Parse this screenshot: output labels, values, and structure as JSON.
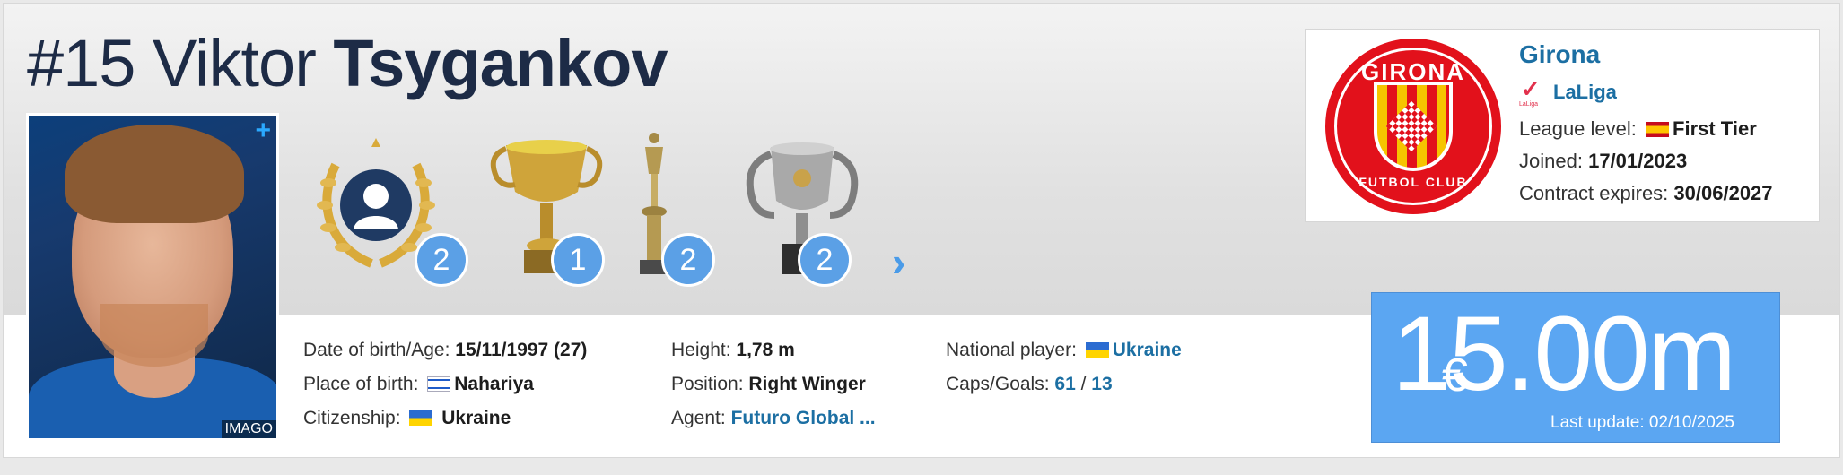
{
  "player": {
    "shirt_number": "#15",
    "first_name": "Viktor",
    "last_name": "Tsygankov",
    "photo_credit": "IMAGO",
    "photo_plus": "+"
  },
  "trophies": [
    {
      "icon": "laurel-portrait-icon",
      "count": "2"
    },
    {
      "icon": "gold-cup-icon",
      "count": "1"
    },
    {
      "icon": "slim-trophy-icon",
      "count": "2"
    },
    {
      "icon": "silver-cup-icon",
      "count": "2"
    }
  ],
  "details": {
    "dob_label": "Date of birth/Age:",
    "dob_value": "15/11/1997 (27)",
    "pob_label": "Place of birth:",
    "pob_value": "Nahariya",
    "citizenship_label": "Citizenship:",
    "citizenship_value": "Ukraine",
    "height_label": "Height:",
    "height_value": "1,78 m",
    "position_label": "Position:",
    "position_value": "Right Winger",
    "agent_label": "Agent:",
    "agent_value": "Futuro Global ...",
    "national_label": "National player:",
    "national_value": "Ukraine",
    "caps_label": "Caps/Goals:",
    "caps_value": "61",
    "caps_sep": "/",
    "goals_value": "13"
  },
  "club": {
    "crest_top_text": "GIRONA",
    "crest_bottom_text": "FUTBOL CLUB",
    "name": "Girona",
    "league": "LaLiga",
    "league_level_label": "League level:",
    "league_level_value": "First Tier",
    "joined_label": "Joined:",
    "joined_value": "17/01/2023",
    "contract_label": "Contract expires:",
    "contract_value": "30/06/2027"
  },
  "market_value": {
    "currency": "€",
    "value": "15.00m",
    "last_update": "Last update: 02/10/2025"
  },
  "colors": {
    "link": "#1c6fa3",
    "badge": "#5ba0e6",
    "market_value_bg": "#5ba6f2",
    "title": "#1d2b46",
    "club_red": "#e2111b"
  }
}
